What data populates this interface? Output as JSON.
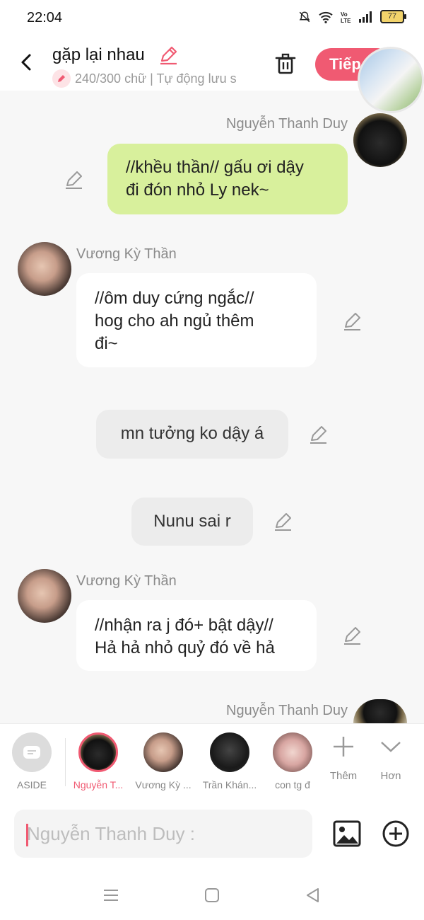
{
  "status_bar": {
    "time": "22:04",
    "battery": "77"
  },
  "header": {
    "title": "gặp lại nhau",
    "subtitle": "240/300 chữ | Tự động lưu s",
    "next_label": "Tiếp"
  },
  "messages": [
    {
      "sender": "Nguyễn Thanh Duy",
      "text_lines": [
        "//khều thần// gấu ơi dậy",
        "đi đón nhỏ Ly nek~"
      ]
    },
    {
      "sender": "Vương Kỳ Thần",
      "text_lines": [
        "//ôm duy cứng ngắc//",
        "hog cho ah ngủ thêm",
        "đi~"
      ]
    },
    {
      "text": "mn tưởng ko dậy á"
    },
    {
      "text": "Nunu sai r"
    },
    {
      "sender": "Vương Kỳ Thần",
      "text_lines": [
        "//nhận ra j đó+ bật dậy//",
        "Hả hả nhỏ quỷ đó về hả"
      ]
    },
    {
      "sender": "Nguyễn Thanh Duy"
    }
  ],
  "characters": [
    {
      "label": "ASIDE"
    },
    {
      "label": "Nguyễn T..."
    },
    {
      "label": "Vương Kỳ ..."
    },
    {
      "label": "Trần Khán..."
    },
    {
      "label": "con tg đ"
    }
  ],
  "tools": {
    "more_label": "Thêm",
    "expand_label": "Hơn"
  },
  "input": {
    "placeholder": "Nguyễn Thanh Duy :"
  },
  "colors": {
    "accent": "#f05a72",
    "green_bubble": "#d8f09c",
    "white_bubble": "#ffffff",
    "grey_bubble": "#ececec"
  }
}
